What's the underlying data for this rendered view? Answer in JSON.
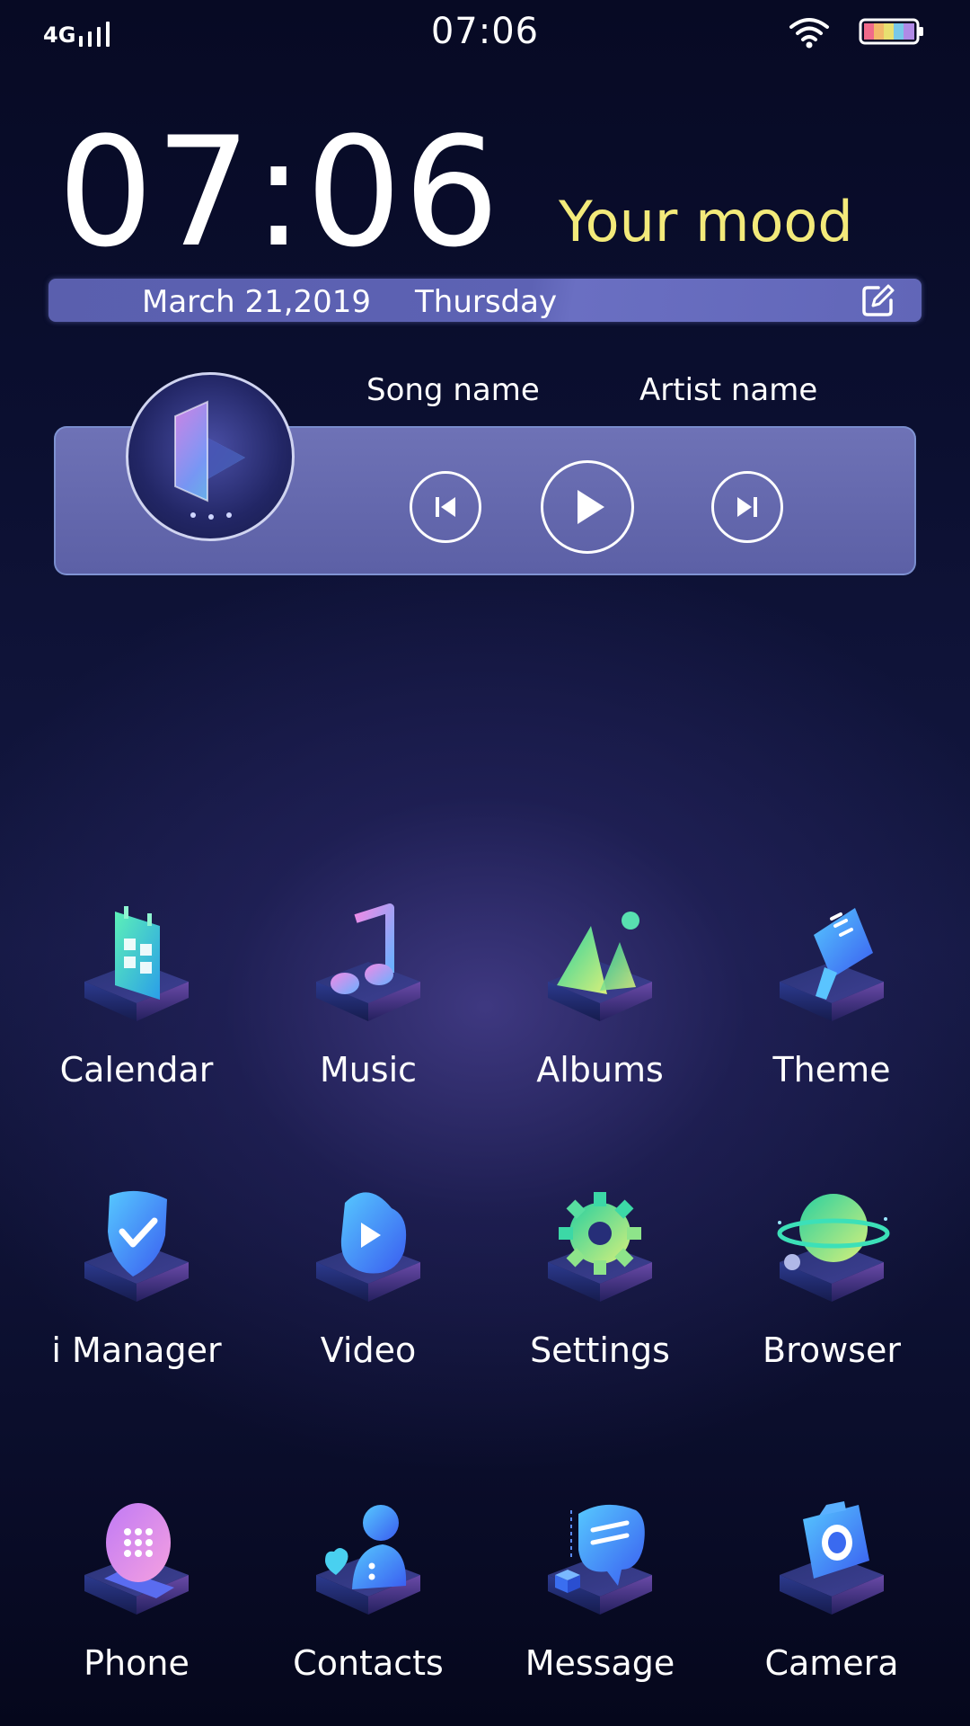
{
  "status_bar": {
    "network": "4G",
    "time": "07:06",
    "icons": [
      "signal-icon",
      "wifi-icon",
      "battery-icon"
    ]
  },
  "clock_widget": {
    "time": "07:06",
    "mood": "Your mood",
    "date": "March 21,2019",
    "day": "Thursday",
    "edit_icon": "edit-icon",
    "mood_color": "#f3ea7a"
  },
  "music_widget": {
    "song": "Song name",
    "artist": "Artist name",
    "controls": [
      "previous-icon",
      "play-icon",
      "next-icon"
    ]
  },
  "apps": [
    {
      "label": "Calendar",
      "icon": "calendar-icon"
    },
    {
      "label": "Music",
      "icon": "music-note-icon"
    },
    {
      "label": "Albums",
      "icon": "albums-icon"
    },
    {
      "label": "Theme",
      "icon": "theme-brush-icon"
    },
    {
      "label": "i Manager",
      "icon": "shield-check-icon"
    },
    {
      "label": "Video",
      "icon": "video-play-icon"
    },
    {
      "label": "Settings",
      "icon": "gear-icon"
    },
    {
      "label": "Browser",
      "icon": "planet-icon"
    },
    {
      "label": "Phone",
      "icon": "dialpad-icon"
    },
    {
      "label": "Contacts",
      "icon": "contacts-icon"
    },
    {
      "label": "Message",
      "icon": "chat-bubble-icon"
    },
    {
      "label": "Camera",
      "icon": "camera-icon"
    }
  ]
}
